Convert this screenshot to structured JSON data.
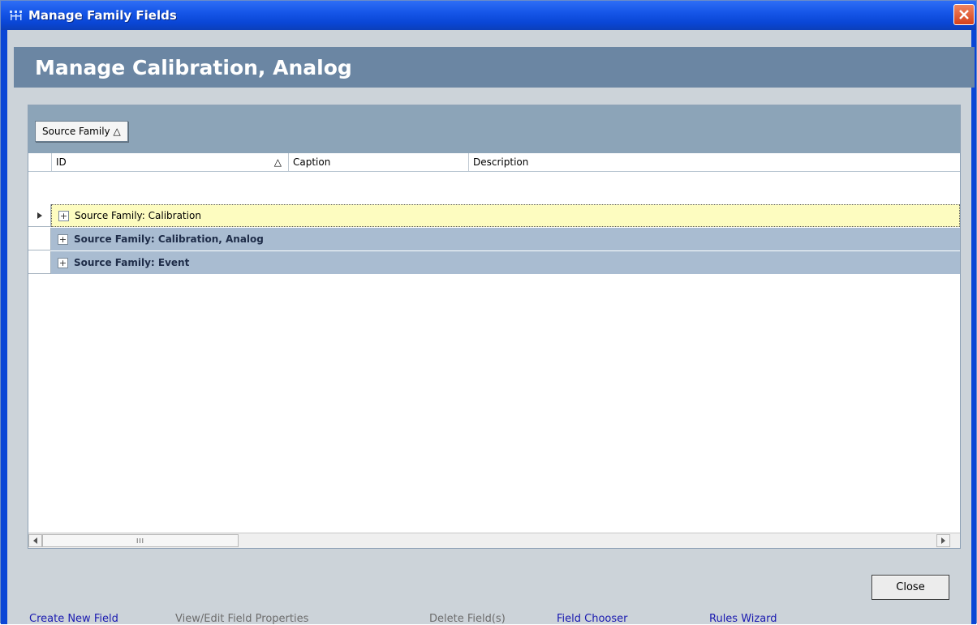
{
  "window": {
    "title": "Manage Family Fields"
  },
  "header": {
    "title": "Manage Calibration, Analog"
  },
  "group_panel": {
    "chip_label": "Source Family △"
  },
  "grid": {
    "columns": [
      {
        "label": "ID",
        "sort": "△"
      },
      {
        "label": "Caption"
      },
      {
        "label": "Description"
      }
    ],
    "rows": [
      {
        "label": "Source Family: Calibration",
        "state": "selected"
      },
      {
        "label": "Source Family: Calibration, Analog",
        "state": "normal"
      },
      {
        "label": "Source Family: Event",
        "state": "normal"
      }
    ],
    "expander_glyph": "+",
    "scroll_thumb_grip": "III"
  },
  "footer": {
    "create_new_field": "Create New Field",
    "view_edit_field_properties": "View/Edit Field Properties",
    "delete_fields": "Delete Field(s)",
    "field_chooser": "Field Chooser",
    "rules_wizard": "Rules Wizard",
    "close": "Close"
  },
  "colors": {
    "titlebar": "#0a46d6",
    "header_band": "#6b86a3",
    "group_panel": "#8ca4b8",
    "row_group": "#a9bcd1",
    "row_selected": "#fdfcc0",
    "link_enabled": "#1a1ab0",
    "link_disabled": "#6d6d6d"
  }
}
